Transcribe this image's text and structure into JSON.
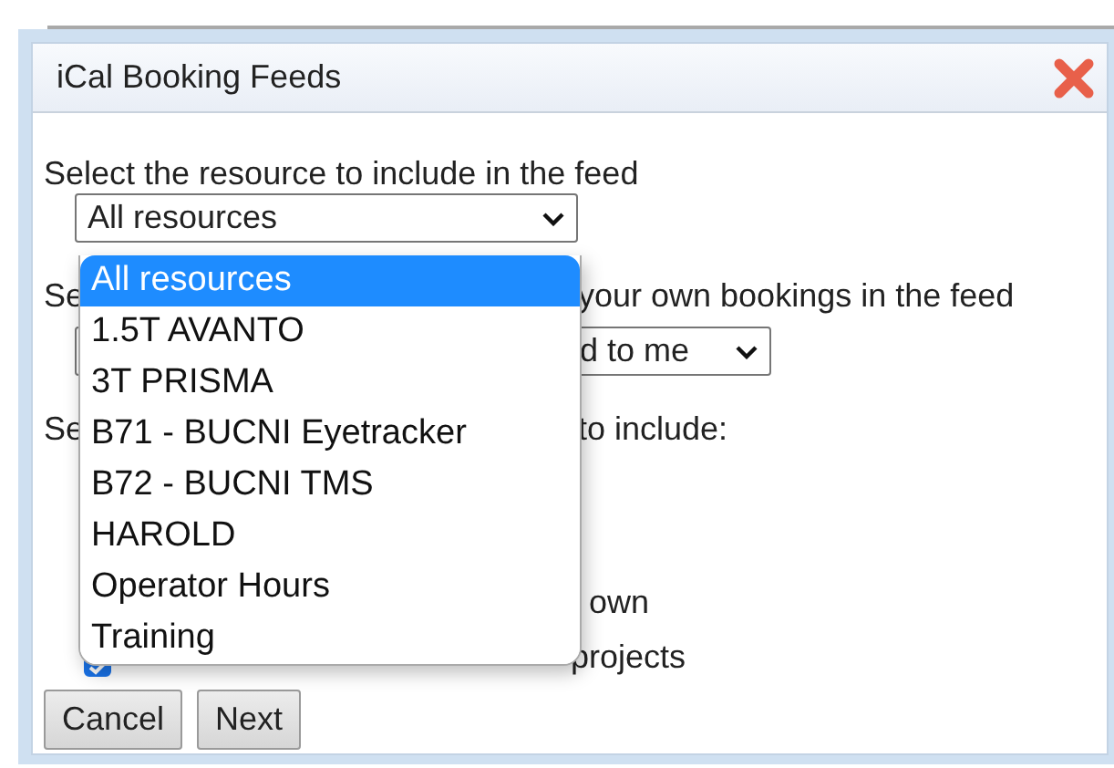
{
  "dialog": {
    "title": "iCal Booking Feeds"
  },
  "resource_prompt": "Select the resource to include in the feed",
  "resource_select": {
    "value": "All resources",
    "expanded": true,
    "options": [
      {
        "label": "All resources",
        "selected": true
      },
      {
        "label": "1.5T AVANTO",
        "selected": false
      },
      {
        "label": "3T PRISMA",
        "selected": false
      },
      {
        "label": "B71 - BUCNI Eyetracker",
        "selected": false
      },
      {
        "label": "B72 - BUCNI TMS",
        "selected": false
      },
      {
        "label": "HAROLD",
        "selected": false
      },
      {
        "label": "Operator Hours",
        "selected": false
      },
      {
        "label": "Training",
        "selected": false
      }
    ]
  },
  "lines": [
    {
      "kind": "text",
      "left": "Se",
      "right": "your own bookings in the feed"
    },
    {
      "kind": "select",
      "value": "d to me"
    },
    {
      "kind": "text",
      "left": "Se",
      "right": "to include:"
    },
    {
      "kind": "option",
      "text": "own"
    },
    {
      "kind": "checkbox",
      "checked": true,
      "text": "projects"
    }
  ],
  "buttons": [
    "Cancel",
    "Next"
  ]
}
